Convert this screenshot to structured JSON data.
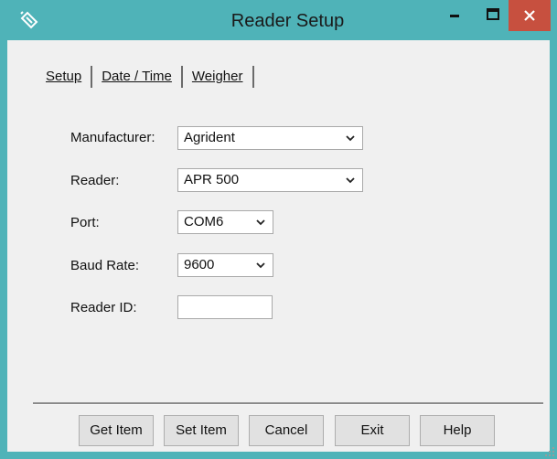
{
  "window": {
    "title": "Reader Setup",
    "titlebar_color": "#4fb3b8",
    "close_color": "#c7503f",
    "icons": {
      "app": "satellite-icon",
      "minimize": "minimize-icon",
      "maximize": "maximize-icon",
      "close": "close-icon"
    }
  },
  "tabs": [
    {
      "label": "Setup",
      "mnemonic": "S",
      "active": true
    },
    {
      "label": "Date / Time",
      "mnemonic": "D",
      "active": false
    },
    {
      "label": "Weigher",
      "mnemonic": "W",
      "active": false
    }
  ],
  "form": {
    "manufacturer": {
      "label": "Manufacturer:",
      "value": "Agrident"
    },
    "reader": {
      "label": "Reader:",
      "value": "APR 500"
    },
    "port": {
      "label": "Port:",
      "value": "COM6"
    },
    "baud_rate": {
      "label": "Baud Rate:",
      "value": "9600"
    },
    "reader_id": {
      "label": "Reader ID:",
      "value": ""
    }
  },
  "buttons": {
    "get_item": "Get Item",
    "set_item": "Set Item",
    "cancel": "Cancel",
    "exit": "Exit",
    "help": "Help"
  }
}
